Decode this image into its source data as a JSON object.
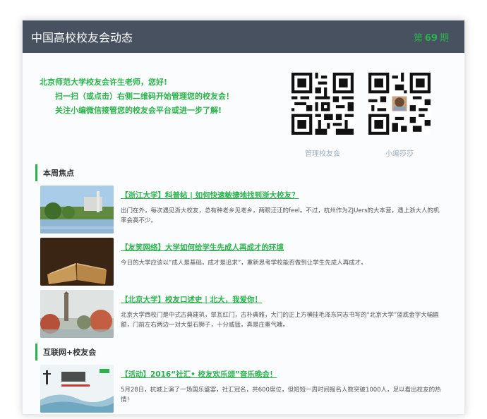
{
  "header": {
    "title": "中国高校校友会动态",
    "issue_prefix": "第",
    "issue_number": "69",
    "issue_suffix": "期"
  },
  "intro": {
    "line1": "北京师范大学校友会许生老师，您好!",
    "line2": "扫一扫（或点击）右侧二维码开始管理您的校友会！",
    "line3": "关注小编微信接管您的校友会平台或进一步了解!"
  },
  "qr_codes": [
    {
      "label": "管理校友会",
      "icon": "qr-code-icon"
    },
    {
      "label": "小编莎莎",
      "icon": "qr-code-avatar-icon"
    }
  ],
  "sections": [
    {
      "title": "本周焦点",
      "items": [
        {
          "title": "【浙江大学】科普帖 | 如何快速敏捷地找到浙大校友？",
          "desc": "出门在外，每次遇见浙大校友，总有种老乡见老乡，两眼汪汪的feel。不过，杭州作为ZJUers的大本营，遇上浙大人的机率会高不少。"
        },
        {
          "title": "【友笑网络】大学如何给学生先成人再成才的环境",
          "desc": "今日的大学应该以“成人是基础，成才是追求”，重新思考学校能否做到让学生先成人再成才。"
        },
        {
          "title": "【北京大学】校友口述史 | 北大，我爱你！",
          "desc": "北京大学西校门是中式古典建筑，翠瓦红门，古朴典雅，大门的正上方横挂毛泽东同志书写的“北京大学”蓝底金字大幅匾额，门前左右两边一对大型石狮子，十分威猛，真是庄重气魄。"
        }
      ]
    },
    {
      "title": "互联网+校友会",
      "items": [
        {
          "title": "【活动】2016“社汇• 校友欢乐颂”音乐晚会！",
          "desc": "5月28日，杭城上演了一场国乐盛宴，社汇冠名，共600席位，但短短一周时间报名人数突破1000人，足以看出校友的热情！"
        }
      ]
    }
  ]
}
